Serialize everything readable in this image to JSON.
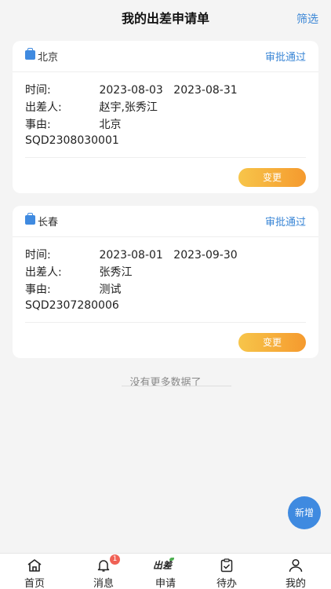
{
  "header": {
    "title": "我的出差申请单",
    "filter_label": "筛选"
  },
  "labels": {
    "time": "时间:",
    "traveler": "出差人:",
    "reason": "事由:"
  },
  "requests": [
    {
      "city": "北京",
      "status": "审批通过",
      "start_date": "2023-08-03",
      "end_date": "2023-08-31",
      "travelers": "赵宇,张秀江",
      "reason": "北京",
      "code": "SQD2308030001",
      "action_label": "变更"
    },
    {
      "city": "长春",
      "status": "审批通过",
      "start_date": "2023-08-01",
      "end_date": "2023-09-30",
      "travelers": "张秀江",
      "reason": "测试",
      "code": "SQD2307280006",
      "action_label": "变更"
    }
  ],
  "list_end_text": "没有更多数据了",
  "fab_label": "新增",
  "tabbar": {
    "items": [
      {
        "label": "首页",
        "icon": "home-icon"
      },
      {
        "label": "消息",
        "icon": "bell-icon",
        "badge": "1"
      },
      {
        "label": "申请",
        "icon": "chuchai-logo-icon",
        "logo_text": "出差"
      },
      {
        "label": "待办",
        "icon": "clipboard-check-icon"
      },
      {
        "label": "我的",
        "icon": "user-icon"
      }
    ]
  },
  "colors": {
    "accent": "#3a86d6",
    "button_gradient_start": "#f7c54a",
    "button_gradient_end": "#f59a2e",
    "badge": "#f06155"
  }
}
